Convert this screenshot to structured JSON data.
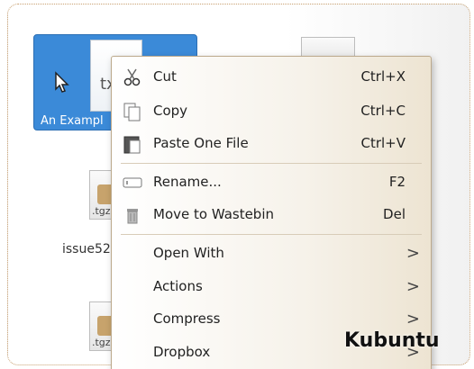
{
  "desktop": {
    "selected_file": {
      "ext": "txt",
      "caption": "An Exampl"
    },
    "tgz_ext": ".tgz",
    "file_caption": "issue52"
  },
  "menu": {
    "items": [
      {
        "label": "Cut",
        "shortcut": "Ctrl+X",
        "icon": "scissors-icon"
      },
      {
        "label": "Copy",
        "shortcut": "Ctrl+C",
        "icon": "copy-icon"
      },
      {
        "label": "Paste One File",
        "shortcut": "Ctrl+V",
        "icon": "paste-icon"
      },
      {
        "label": "Rename...",
        "shortcut": "F2",
        "icon": "rename-icon"
      },
      {
        "label": "Move to Wastebin",
        "shortcut": "Del",
        "icon": "trash-icon"
      },
      {
        "label": "Open With",
        "submenu": true
      },
      {
        "label": "Actions",
        "submenu": true
      },
      {
        "label": "Compress",
        "submenu": true
      },
      {
        "label": "Dropbox",
        "submenu": true
      }
    ],
    "submenu_arrow": ">"
  },
  "brand": "Kubuntu"
}
